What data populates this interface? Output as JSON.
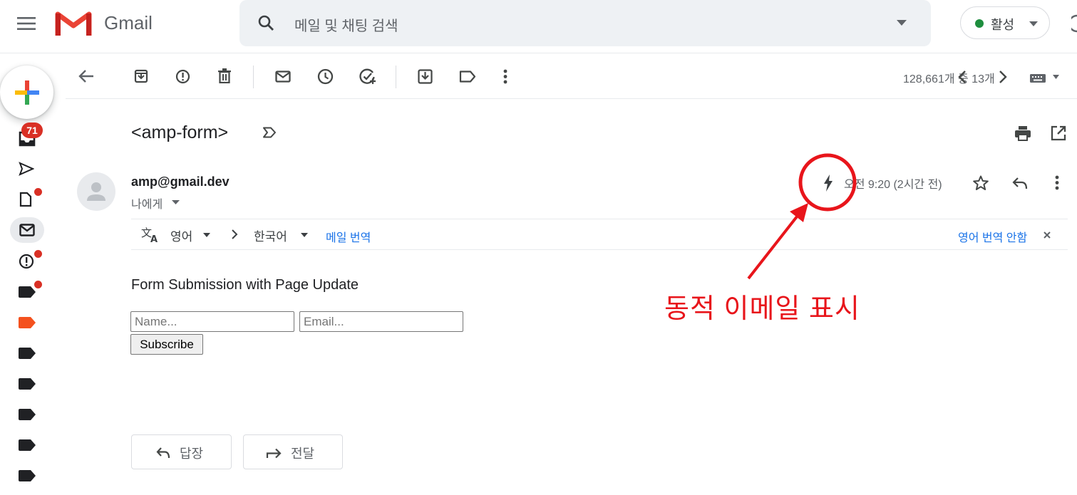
{
  "app": {
    "brand": "Gmail"
  },
  "search": {
    "placeholder": "메일 및 채팅 검색"
  },
  "status": {
    "label": "활성",
    "color": "#1e8e3e"
  },
  "left_nav": {
    "inbox_badge": "71"
  },
  "toolbar": {
    "pager_text": "128,661개 중 13개"
  },
  "message": {
    "subject": "<amp-form>",
    "sender": "amp@gmail.dev",
    "recipient": "나에게",
    "time": "오전 9:20 (2시간 전)"
  },
  "translate": {
    "source_lang": "영어",
    "target_lang": "한국어",
    "translate_link": "메일 번역",
    "dont_translate": "영어 번역 안함"
  },
  "email_body": {
    "title": "Form Submission with Page Update",
    "name_placeholder": "Name...",
    "email_placeholder": "Email...",
    "submit_label": "Subscribe"
  },
  "actions": {
    "reply": "답장",
    "forward": "전달"
  },
  "annotation": {
    "text": "동적 이메일 표시",
    "color": "#e8151b"
  },
  "colors": {
    "accent_blue": "#1a73e8",
    "badge_red": "#d93025",
    "label_orange": "#f4511e"
  }
}
